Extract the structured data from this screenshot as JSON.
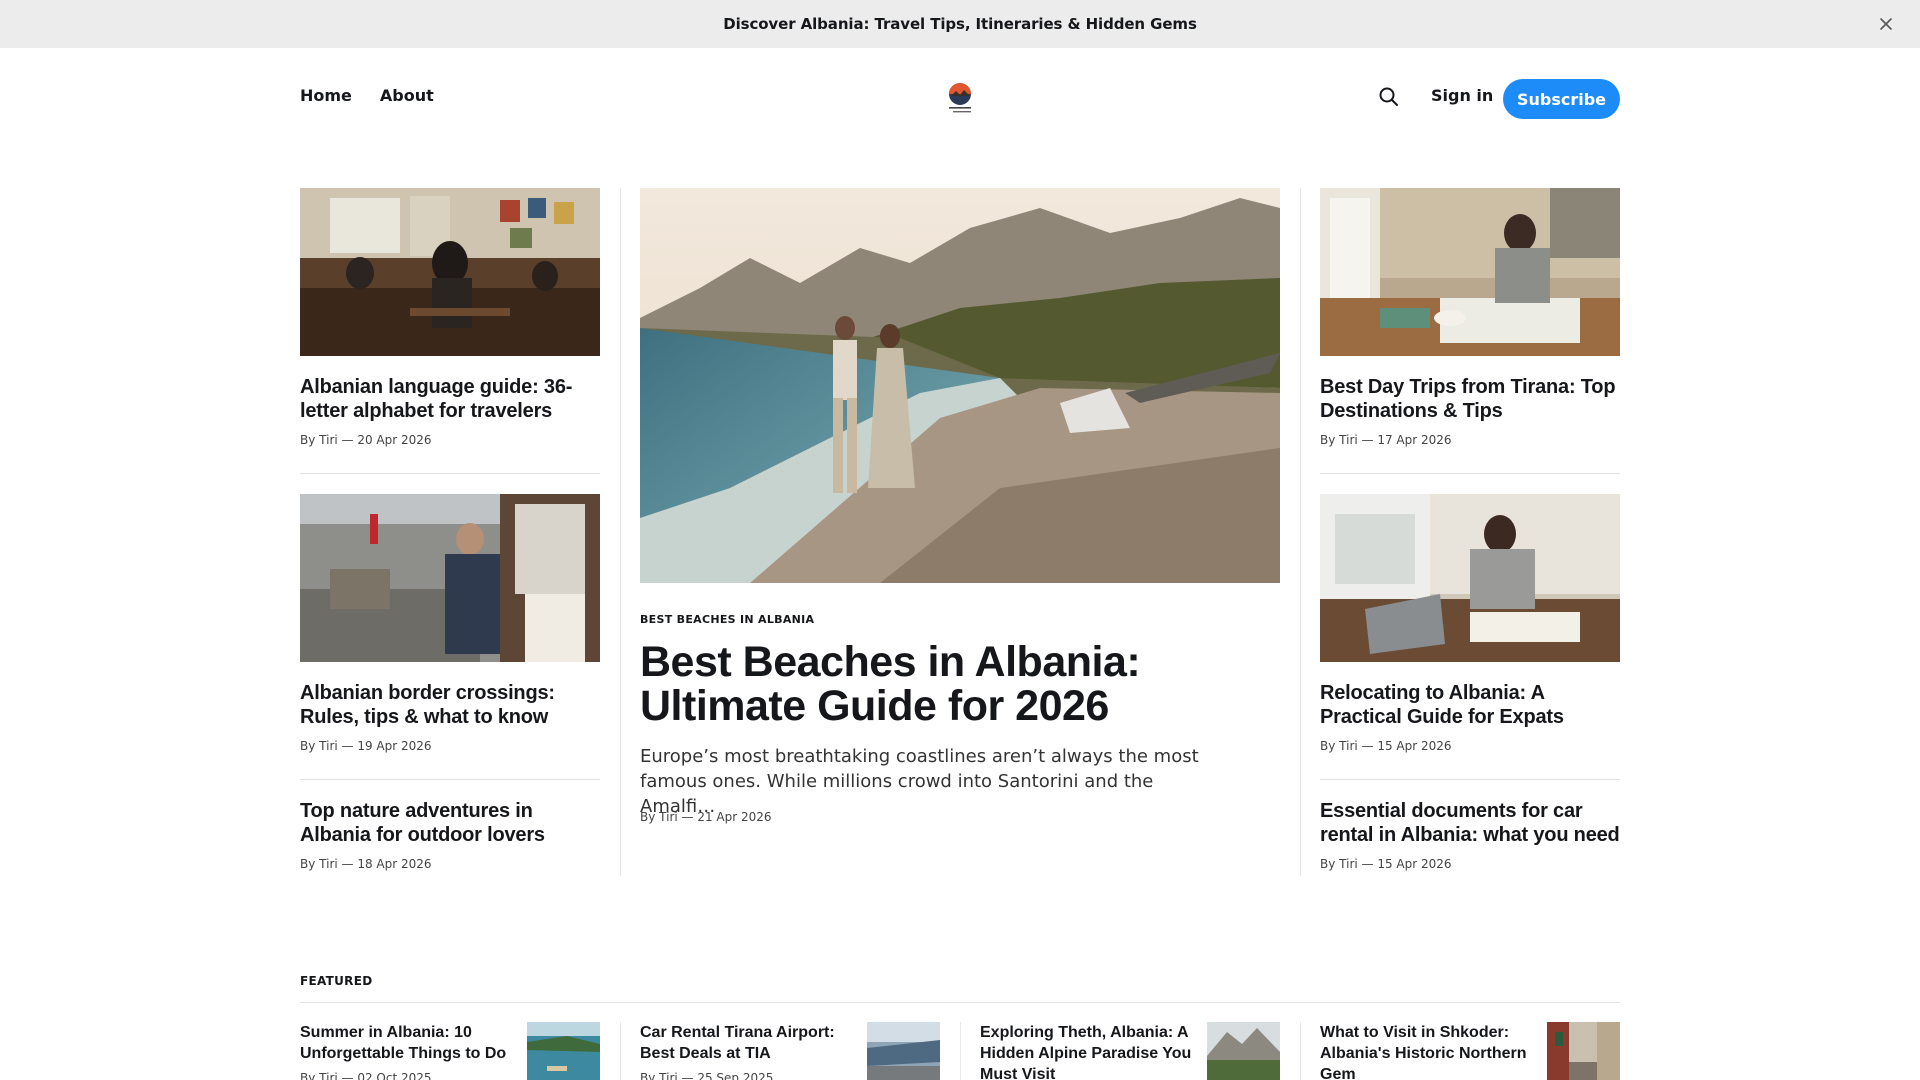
{
  "announcement": {
    "text": "Discover Albania: Travel Tips, Itineraries & Hidden Gems"
  },
  "nav": {
    "home": "Home",
    "about": "About"
  },
  "header": {
    "sign_in": "Sign in",
    "subscribe": "Subscribe"
  },
  "left_column": [
    {
      "title": "Albanian language guide: 36-letter alphabet for travelers",
      "meta": "By Tiri — 20 Apr 2026"
    },
    {
      "title": "Albanian border crossings: Rules, tips & what to know",
      "meta": "By Tiri — 19 Apr 2026"
    },
    {
      "title": "Top nature adventures in Albania for outdoor lovers",
      "meta": "By Tiri — 18 Apr 2026"
    }
  ],
  "hero": {
    "tag": "BEST BEACHES IN ALBANIA",
    "title": "Best Beaches in Albania: Ultimate Guide for 2026",
    "excerpt": "Europe’s most breathtaking coastlines aren’t always the most famous ones. While millions crowd into Santorini and the Amalfi…",
    "meta": "By Tiri — 21 Apr 2026"
  },
  "right_column": [
    {
      "title": "Best Day Trips from Tirana: Top Destinations & Tips",
      "meta": "By Tiri — 17 Apr 2026"
    },
    {
      "title": "Relocating to Albania: A Practical Guide for Expats",
      "meta": "By Tiri — 15 Apr 2026"
    },
    {
      "title": "Essential documents for car rental in Albania: what you need",
      "meta": "By Tiri — 15 Apr 2026"
    }
  ],
  "featured": {
    "label": "FEATURED",
    "items": [
      {
        "title": "Summer in Albania: 10 Unforgettable Things to Do",
        "meta": "By Tiri — 02 Oct 2025"
      },
      {
        "title": "Car Rental Tirana Airport: Best Deals at TIA",
        "meta": "By Tiri — 25 Sep 2025"
      },
      {
        "title": "Exploring Theth, Albania: A Hidden Alpine Paradise You Must Visit",
        "meta": ""
      },
      {
        "title": "What to Visit in Shkoder: Albania's Historic Northern Gem",
        "meta": ""
      }
    ]
  },
  "colors": {
    "accent": "#1d8cf8",
    "announcement_bg": "#ececec"
  }
}
